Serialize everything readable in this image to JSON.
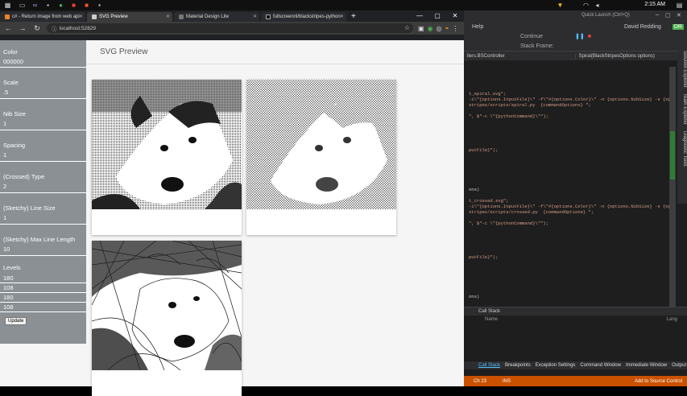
{
  "taskbar": {
    "clock": "2:15 AM"
  },
  "browser": {
    "tabs": [
      {
        "label": "c# - Return image from web api"
      },
      {
        "label": "SVG Preview",
        "active": true
      },
      {
        "label": "Material Design Lite"
      },
      {
        "label": "fullscreennl/blackstripes-python"
      }
    ],
    "url": "localhost:52829"
  },
  "page": {
    "title": "SVG Preview"
  },
  "sidebar": {
    "fields": [
      {
        "label": "Color",
        "value": "000000"
      },
      {
        "label": "Scale",
        "value": ".5"
      },
      {
        "label": "Nib Size",
        "value": "1"
      },
      {
        "label": "Spacing",
        "value": "1"
      },
      {
        "label": "(Crossed) Type",
        "value": "2"
      },
      {
        "label": "(Sketchy) Line Size",
        "value": "1"
      },
      {
        "label": "(Sketchy) Max Line Length",
        "value": "10"
      }
    ],
    "levels_label": "Levels",
    "levels": [
      "180",
      "108",
      "180",
      "108"
    ],
    "update_label": "Update"
  },
  "ide": {
    "quick_launch": "Quick Launch (Ctrl+Q)",
    "menu_help": "Help",
    "user": "David Redding",
    "continue_label": "Continue",
    "stack_frame": "Stack Frame:",
    "nav_left": "llers.BSController",
    "nav_right": "Spiral(BlackStripesOptions options)",
    "code_lines": [
      "",
      "",
      "",
      "",
      "t_spiral.svg\";",
      "-i\\\"{options.InputFile}\\\" -f\\\"#{options.Color}\\\" -n {options.NibSize} -s {options",
      "stripes/scripts/spiral.py  {commandOptions} \";",
      "",
      "\", $\"-c \\\"{pythonCommand}\\\"\");",
      "",
      "",
      "",
      "",
      "",
      "putFile}\");",
      "",
      "",
      "",
      "",
      "",
      "",
      "ons)",
      "",
      "t_crossed.svg\";",
      "-i\\\"{options.InputFile}\\\" -f\\\"#{options.Color}\\\" -n {options.NibSize} -s {options",
      "stripes/scripts/crossed.py  {commandOptions} \";",
      "",
      "\", $\"-c \\\"{pythonCommand}\\\"\");",
      "",
      "",
      "",
      "",
      "",
      "putFile}\");",
      "",
      "",
      "",
      "",
      "",
      "",
      "ons)"
    ],
    "side_tools": [
      "Solution Explorer",
      "Team Explorer",
      "Diagnostic Tools"
    ],
    "call_stack_title": "Call Stack",
    "call_stack_col_name": "Name",
    "call_stack_col_lang": "Lang",
    "bottom_tabs": [
      "Call Stack",
      "Breakpoints",
      "Exception Settings",
      "Command Window",
      "Immediate Window",
      "Output"
    ],
    "status_ch": "Ch 23",
    "status_ins": "INS",
    "status_source": "Add to Source Control"
  }
}
